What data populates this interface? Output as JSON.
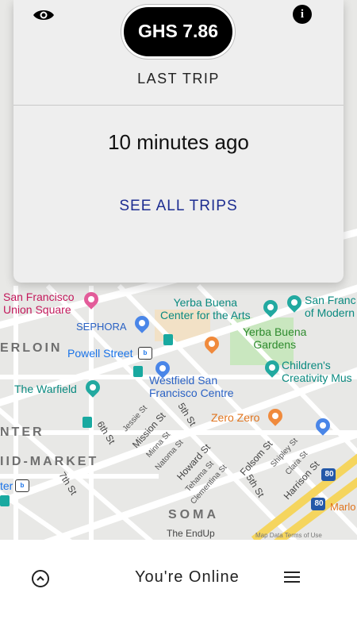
{
  "card": {
    "fare": "GHS 7.86",
    "last_trip_label": "LAST TRIP",
    "time_ago": "10 minutes ago",
    "see_all_trips": "SEE ALL TRIPS"
  },
  "icons": {
    "eye": "eye-icon",
    "info": "info-icon",
    "expand": "chevron-up-circle-icon",
    "menu": "hamburger-menu-icon"
  },
  "info_glyph": "i",
  "bottom_bar": {
    "status": "You're Online"
  },
  "map": {
    "places": {
      "sf_union_square": "San Francisco\nUnion Square",
      "sephora": "SEPHORA",
      "tenderloin": "ERLOIN",
      "powell_street": "Powell Street",
      "warfield": "The Warfield",
      "yerba_buena_center": "Yerba Buena\nCenter for the Arts",
      "yerba_buena_gardens": "Yerba Buena\nGardens",
      "sfmoma": "San Franc\nof Modern",
      "childrens_museum": "Children's\nCreativity Mus",
      "westfield": "Westfield San\nFrancisco Centre",
      "zero_zero": "Zero Zero",
      "center": "NTER",
      "mid_market": "IID-MARKET",
      "soma": "SOMA",
      "the_endup": "The EndUp",
      "marlo": "Marlo",
      "ter": "ter"
    },
    "streets": [
      "Jessie St",
      "Mission St",
      "5th St",
      "6th St",
      "Minna St",
      "Natoma St",
      "Howard St",
      "Tehama St",
      "Clementina St",
      "Folsom St",
      "5th St",
      "Shipley St",
      "Clara St",
      "Harrison St",
      "7th St"
    ],
    "highway": "80",
    "footer": "Map Data   Terms of Use"
  }
}
